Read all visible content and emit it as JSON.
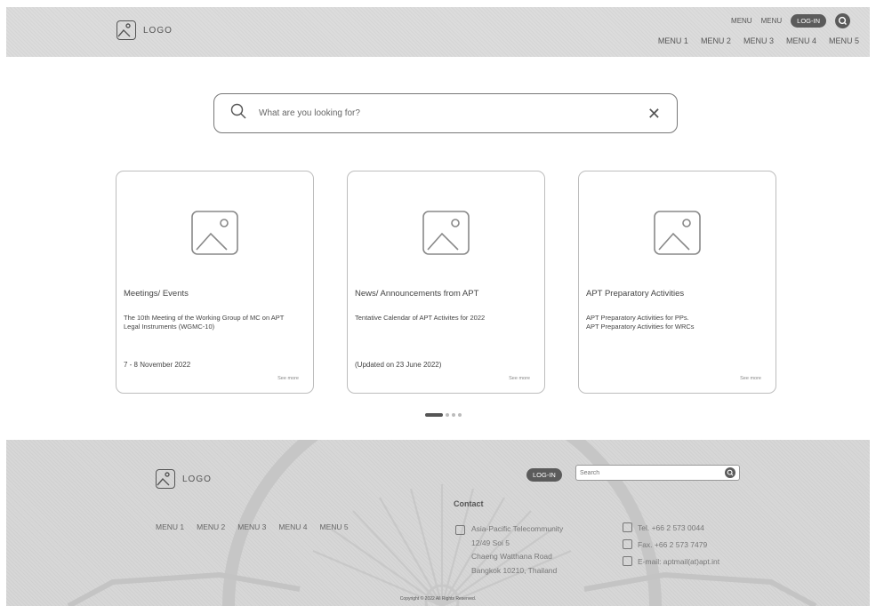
{
  "header": {
    "logo_text": "LOGO",
    "top_links": [
      "MENU",
      "MENU"
    ],
    "login_label": "LOG-IN",
    "nav": [
      "MENU 1",
      "MENU 2",
      "MENU 3",
      "MENU 4",
      "MENU 5"
    ]
  },
  "search": {
    "placeholder": "What are you looking for?"
  },
  "cards": [
    {
      "title": "Meetings/ Events",
      "description": "The 10th Meeting of the Working Group of MC on APT Legal Instruments (WGMC-10)",
      "date": "7 - 8 November 2022",
      "see_more": "See more"
    },
    {
      "title": "News/ Announcements from APT",
      "description": "Tentative Calendar of APT Activites for 2022",
      "date": "(Updated on 23 June 2022)",
      "see_more": "See more"
    },
    {
      "title": "APT Preparatory Activities",
      "description": "APT Preparatory Activities for PPs.\nAPT Preparatory Activities for WRCs",
      "date": "",
      "see_more": "See more"
    }
  ],
  "pager": {
    "total": 4,
    "active": 0
  },
  "footer": {
    "logo_text": "LOGO",
    "login_label": "LOG-IN",
    "search_placeholder": "Search",
    "nav": [
      "MENU 1",
      "MENU 2",
      "MENU 3",
      "MENU 4",
      "MENU 5"
    ],
    "contact_title": "Contact",
    "address": [
      "Asia-Pacific Telecommunity",
      "12/49 Soi 5",
      "Chaeng Watthana Road",
      "Bangkok 10210, Thailand"
    ],
    "tel": "Tel. +66 2 573 0044",
    "fax": "Fax. +66 2 573 7479",
    "email": "E-mail: aptmail(at)apt.int",
    "copyright": "Copyright © 2022 All Rights Reserved."
  }
}
